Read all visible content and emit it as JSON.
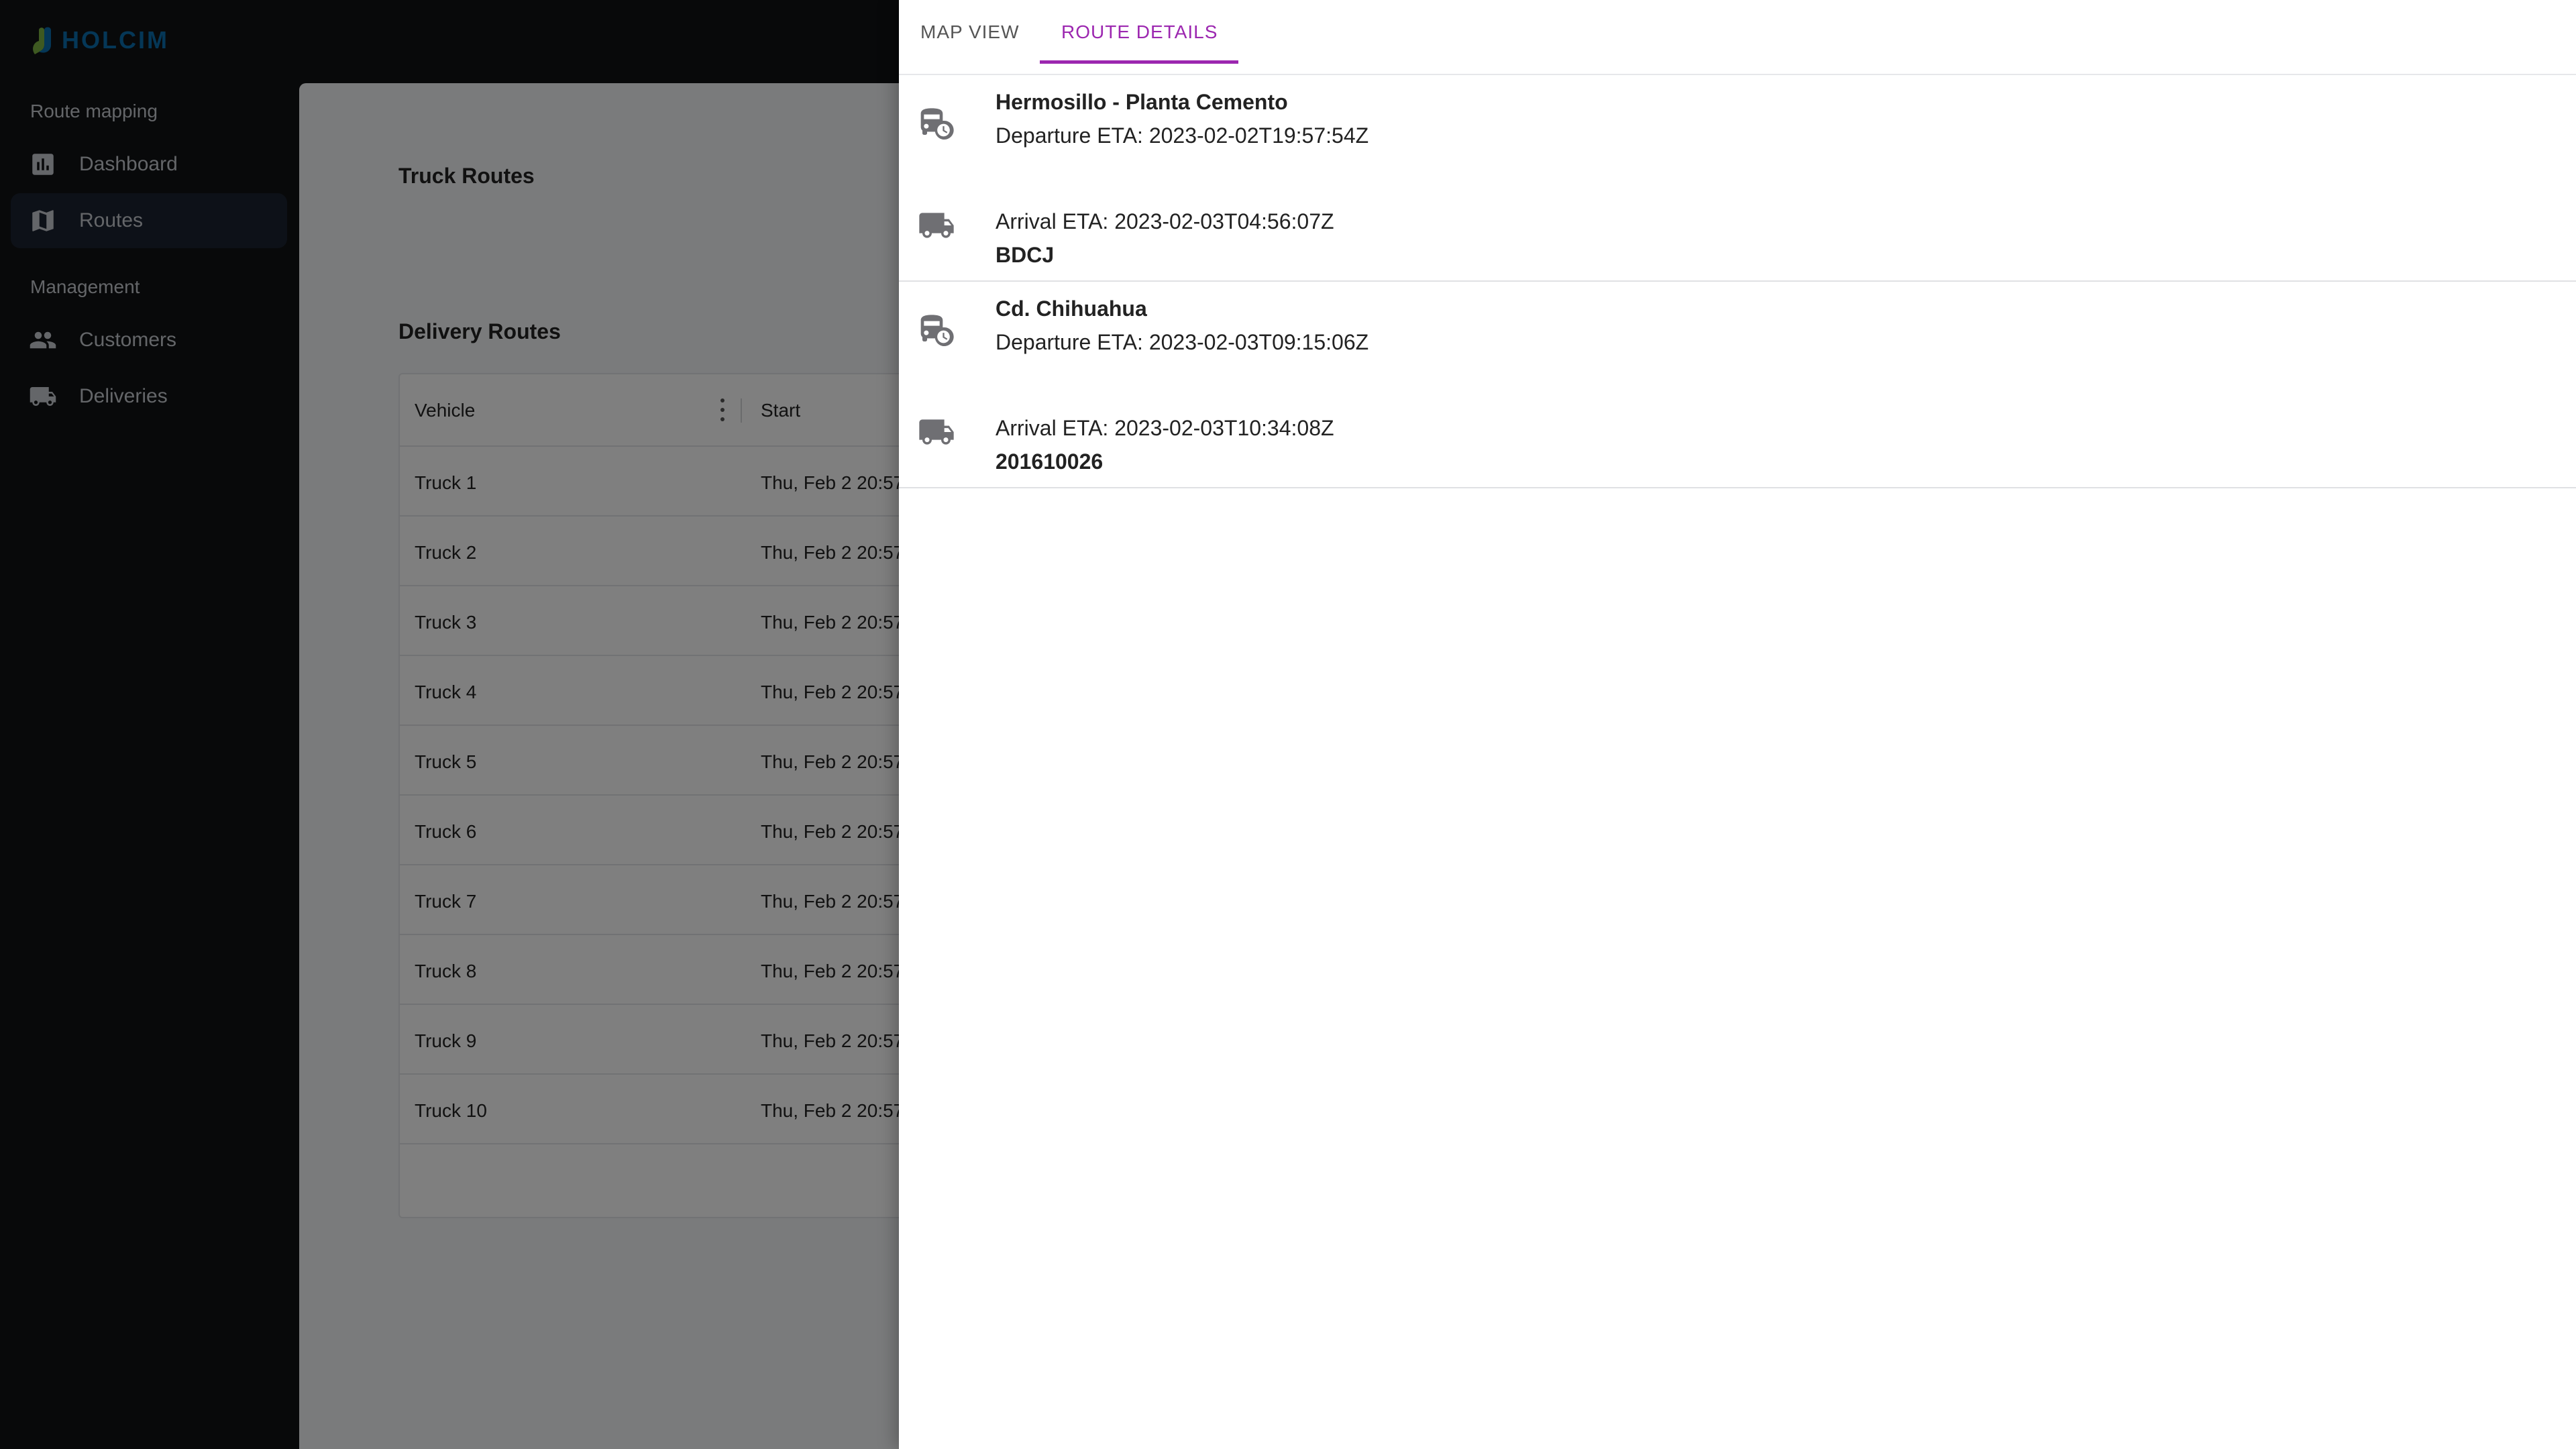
{
  "app": {
    "brand": "HOLCIM"
  },
  "sidebar": {
    "sections": [
      {
        "label": "Route mapping",
        "items": [
          {
            "label": "Dashboard",
            "icon": "bar-chart-icon",
            "active": false
          },
          {
            "label": "Routes",
            "icon": "map-icon",
            "active": true
          }
        ]
      },
      {
        "label": "Management",
        "items": [
          {
            "label": "Customers",
            "icon": "people-icon",
            "active": false
          },
          {
            "label": "Deliveries",
            "icon": "truck-icon",
            "active": false
          }
        ]
      }
    ]
  },
  "main": {
    "truck_routes_title": "Truck Routes",
    "delivery_routes_title": "Delivery Routes",
    "table": {
      "columns": [
        "Vehicle",
        "Start"
      ],
      "rows": [
        {
          "vehicle": "Truck 1",
          "start": "Thu, Feb 2 20:57"
        },
        {
          "vehicle": "Truck 2",
          "start": "Thu, Feb 2 20:57"
        },
        {
          "vehicle": "Truck 3",
          "start": "Thu, Feb 2 20:57"
        },
        {
          "vehicle": "Truck 4",
          "start": "Thu, Feb 2 20:57"
        },
        {
          "vehicle": "Truck 5",
          "start": "Thu, Feb 2 20:57"
        },
        {
          "vehicle": "Truck 6",
          "start": "Thu, Feb 2 20:57"
        },
        {
          "vehicle": "Truck 7",
          "start": "Thu, Feb 2 20:57"
        },
        {
          "vehicle": "Truck 8",
          "start": "Thu, Feb 2 20:57"
        },
        {
          "vehicle": "Truck 9",
          "start": "Thu, Feb 2 20:57"
        },
        {
          "vehicle": "Truck 10",
          "start": "Thu, Feb 2 20:57"
        }
      ]
    }
  },
  "drawer": {
    "tabs": [
      {
        "label": "MAP VIEW",
        "active": false
      },
      {
        "label": "ROUTE DETAILS",
        "active": true
      }
    ],
    "stops": [
      {
        "name": "Hermosillo - Planta Cemento",
        "departure": "Departure ETA: 2023-02-02T19:57:54Z",
        "arrival": "Arrival ETA: 2023-02-03T04:56:07Z",
        "code": "BDCJ"
      },
      {
        "name": "Cd. Chihuahua",
        "departure": "Departure ETA: 2023-02-03T09:15:06Z",
        "arrival": "Arrival ETA: 2023-02-03T10:34:08Z",
        "code": "201610026"
      }
    ]
  },
  "colors": {
    "accent": "#9c27b0",
    "sidebar_bg": "#111315",
    "sidebar_active": "#1b2230",
    "brand_blue": "#0b6fae",
    "brand_green": "#7cb342"
  }
}
